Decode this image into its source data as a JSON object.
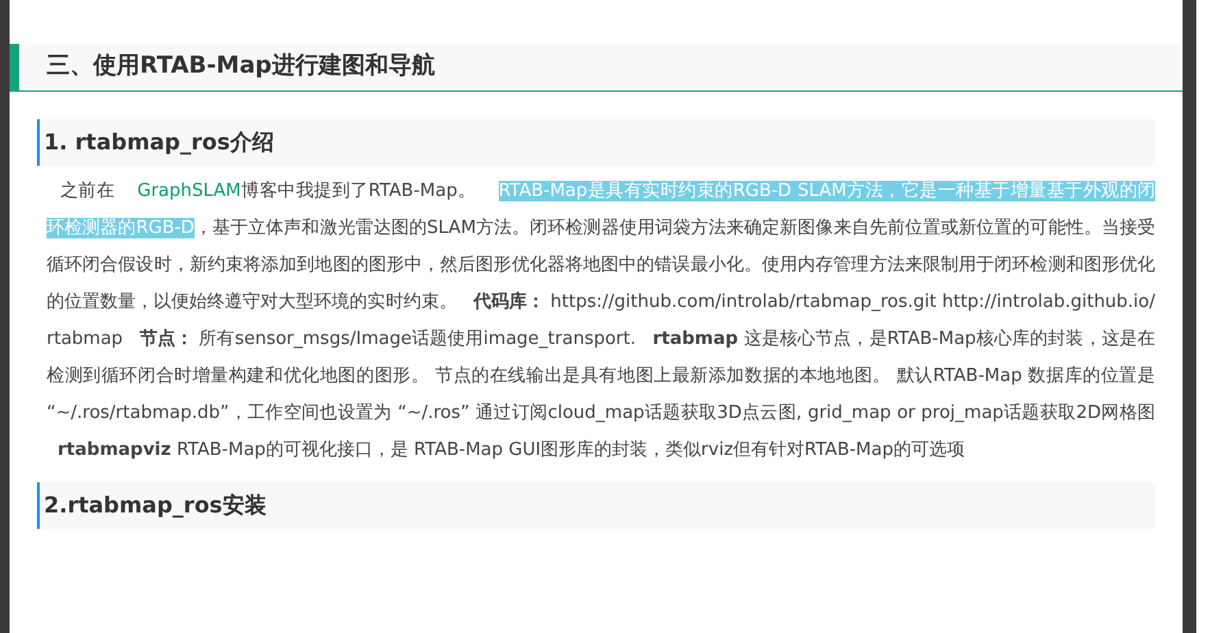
{
  "section_heading": "三、使用RTAB-Map进行建图和导航",
  "subsections": [
    {
      "heading": "1. rtabmap_ros介绍",
      "paragraph": [
        {
          "kind": "text",
          "text": "之前在 "
        },
        {
          "kind": "link",
          "text": "GraphSLAM"
        },
        {
          "kind": "text",
          "text": "博客中我提到了RTAB-Map。 "
        },
        {
          "kind": "highlight",
          "text": "RTAB-Map是具有实时约束的RGB-D SLAM方法，它是一种基于增量基于外观的闭环检测器的RGB-D"
        },
        {
          "kind": "text",
          "text": "，基于立体声和激光雷达图的SLAM方法。闭环检测器使用词袋方法来确定新图像来自先前位置或新位置的可能性。当接受循环闭合假设时，新约束将添加到地图的图形中，然后图形优化器将地图中的错误最小化。使用内存管理方法来限制用于闭环检测和图形优化的位置数量，以便始终遵守对大型环境的实时约束。 "
        },
        {
          "kind": "bold",
          "text": "代码库："
        },
        {
          "kind": "text",
          "text": " https://github.com/introlab/rtabmap_ros.git http://introlab.github.io/rtabmap "
        },
        {
          "kind": "bold",
          "text": "节点："
        },
        {
          "kind": "text",
          "text": " 所有sensor_msgs/Image话题使用image_transport. "
        },
        {
          "kind": "bold",
          "text": "rtabmap"
        },
        {
          "kind": "text",
          "text": " 这是核心节点，是RTAB-Map核心库的封装，这是在检测到循环闭合时增量构建和优化地图的图形。 节点的在线输出是具有地图上最新添加数据的本地地图。 默认RTAB-Map 数据库的位置是 “~/.ros/rtabmap.db”，工作空间也设置为 “~/.ros” 通过订阅cloud_map话题获取3D点云图, grid_map or proj_map话题获取2D网格图 "
        },
        {
          "kind": "bold",
          "text": "rtabmapviz"
        },
        {
          "kind": "text",
          "text": " RTAB-Map的可视化接口，是 RTAB-Map GUI图形库的封装，类似rviz但有针对RTAB-Map的可选项"
        }
      ]
    },
    {
      "heading": "2.rtabmap_ros安装"
    }
  ]
}
